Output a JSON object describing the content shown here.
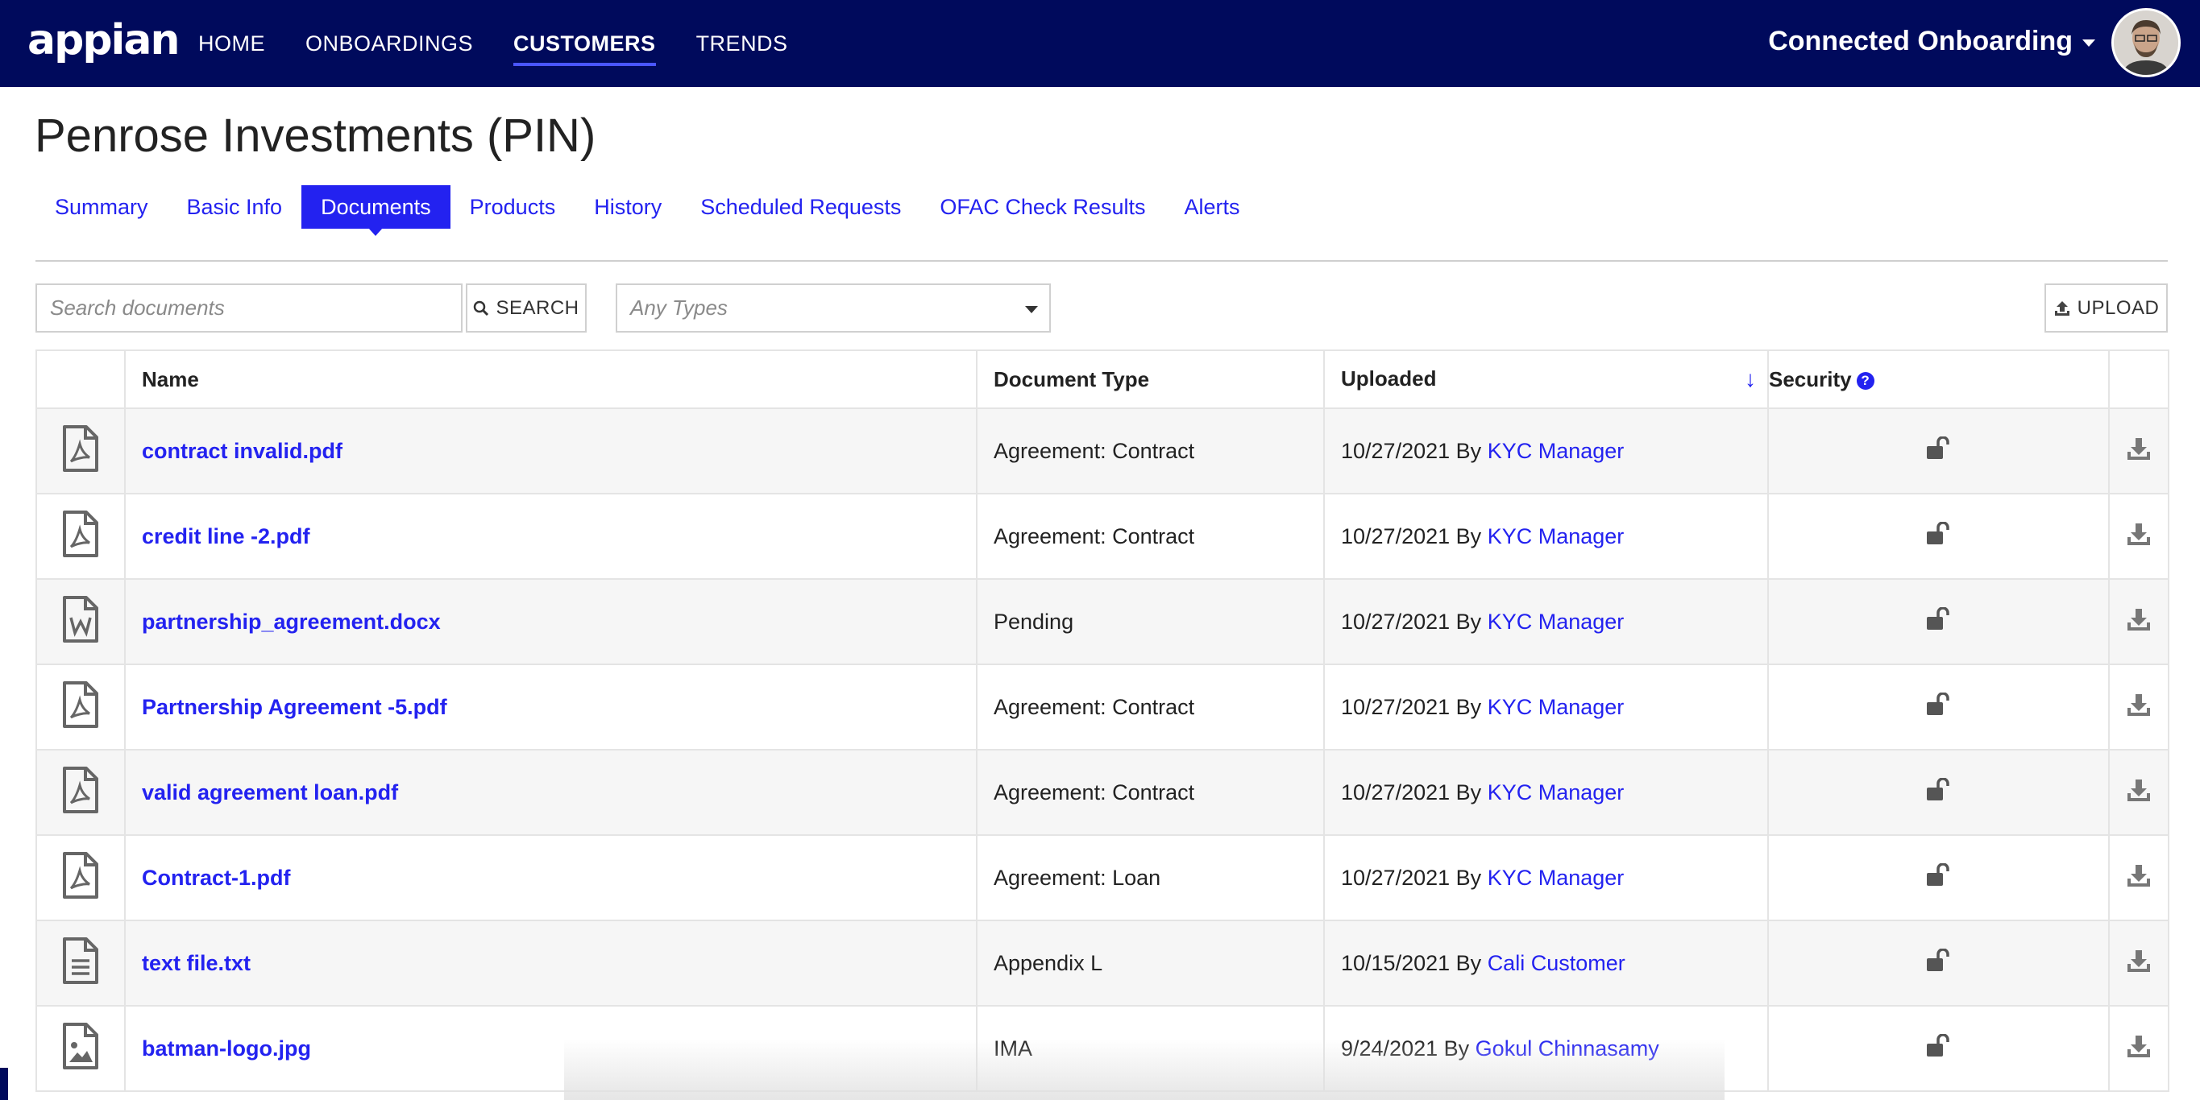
{
  "topbar": {
    "logo": "appian",
    "nav": [
      {
        "label": "HOME",
        "active": false
      },
      {
        "label": "ONBOARDINGS",
        "active": false
      },
      {
        "label": "CUSTOMERS",
        "active": true
      },
      {
        "label": "TRENDS",
        "active": false
      }
    ],
    "site_name": "Connected Onboarding",
    "colors": {
      "bar": "#000a5c",
      "accent": "#2322f0"
    }
  },
  "page": {
    "title": "Penrose Investments (PIN)",
    "tabs": [
      {
        "label": "Summary",
        "active": false
      },
      {
        "label": "Basic Info",
        "active": false
      },
      {
        "label": "Documents",
        "active": true
      },
      {
        "label": "Products",
        "active": false
      },
      {
        "label": "History",
        "active": false
      },
      {
        "label": "Scheduled Requests",
        "active": false
      },
      {
        "label": "OFAC Check Results",
        "active": false
      },
      {
        "label": "Alerts",
        "active": false
      }
    ]
  },
  "toolbar": {
    "search_placeholder": "Search documents",
    "search_label": "SEARCH",
    "type_filter": "Any Types",
    "upload_label": "UPLOAD"
  },
  "table": {
    "headers": {
      "name": "Name",
      "doc_type": "Document Type",
      "uploaded": "Uploaded",
      "security": "Security"
    },
    "sort": "uploaded-desc",
    "rows": [
      {
        "icon": "pdf-file-icon",
        "name": "contract invalid.pdf",
        "type": "Agreement: Contract",
        "date": "10/27/2021",
        "by": "By",
        "user": "KYC Manager"
      },
      {
        "icon": "pdf-file-icon",
        "name": "credit line -2.pdf",
        "type": "Agreement: Contract",
        "date": "10/27/2021",
        "by": "By",
        "user": "KYC Manager"
      },
      {
        "icon": "word-file-icon",
        "name": "partnership_agreement.docx",
        "type": "Pending",
        "date": "10/27/2021",
        "by": "By",
        "user": "KYC Manager"
      },
      {
        "icon": "pdf-file-icon",
        "name": "Partnership Agreement -5.pdf",
        "type": "Agreement: Contract",
        "date": "10/27/2021",
        "by": "By",
        "user": "KYC Manager"
      },
      {
        "icon": "pdf-file-icon",
        "name": "valid agreement loan.pdf",
        "type": "Agreement: Contract",
        "date": "10/27/2021",
        "by": "By",
        "user": "KYC Manager"
      },
      {
        "icon": "pdf-file-icon",
        "name": "Contract-1.pdf",
        "type": "Agreement: Loan",
        "date": "10/27/2021",
        "by": "By",
        "user": "KYC Manager"
      },
      {
        "icon": "text-file-icon",
        "name": "text file.txt",
        "type": "Appendix L",
        "date": "10/15/2021",
        "by": "By",
        "user": "Cali Customer"
      },
      {
        "icon": "image-file-icon",
        "name": "batman-logo.jpg",
        "type": "IMA",
        "date": "9/24/2021",
        "by": "By",
        "user": "Gokul Chinnasamy"
      }
    ]
  }
}
